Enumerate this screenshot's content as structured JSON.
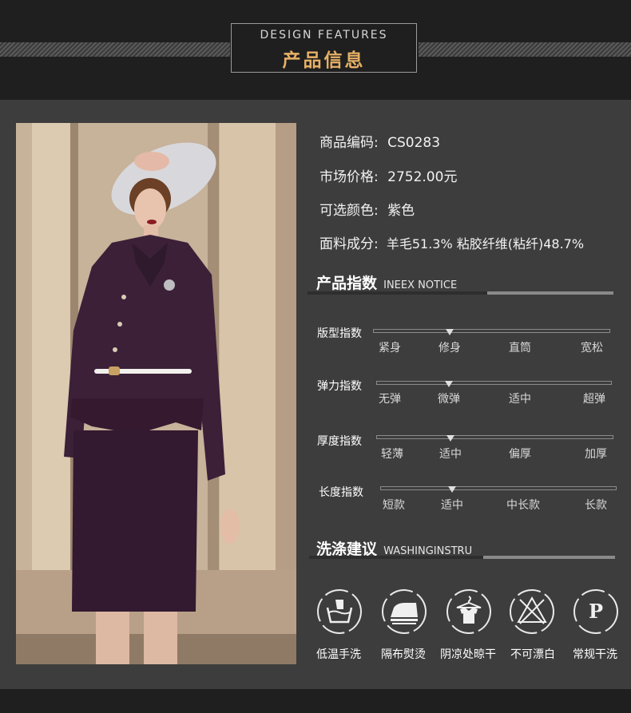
{
  "header": {
    "title_en": "DESIGN FEATURES",
    "title_cn": "产品信息"
  },
  "product": {
    "code_label": "商品编码:",
    "code_value": "CS0283",
    "price_label": "市场价格:",
    "price_value": "2752.00元",
    "color_label": "可选颜色:",
    "color_value": "紫色",
    "fabric_label": "面料成分:",
    "fabric_value": "羊毛51.3% 粘胶纤维(粘纤)48.7%"
  },
  "index_section": {
    "title_cn": "产品指数",
    "title_en": "INEEX NOTICE",
    "rows": [
      {
        "label": "版型指数",
        "options": [
          "紧身",
          "修身",
          "直筒",
          "宽松"
        ],
        "selected": 1
      },
      {
        "label": "弹力指数",
        "options": [
          "无弹",
          "微弹",
          "适中",
          "超弹"
        ],
        "selected": 1
      },
      {
        "label": "厚度指数",
        "options": [
          "轻薄",
          "适中",
          "偏厚",
          "加厚"
        ],
        "selected": 1
      },
      {
        "label": "长度指数",
        "options": [
          "短款",
          "适中",
          "中长款",
          "长款"
        ],
        "selected": 1
      }
    ]
  },
  "wash_section": {
    "title_cn": "洗涤建议",
    "title_en": "WASHINGINSTRU",
    "items": [
      {
        "label": "低温手洗",
        "icon": "hand-wash-icon"
      },
      {
        "label": "隔布熨烫",
        "icon": "iron-icon"
      },
      {
        "label": "阴凉处晾干",
        "icon": "hang-dry-icon"
      },
      {
        "label": "不可漂白",
        "icon": "no-bleach-icon"
      },
      {
        "label": "常规干洗",
        "icon": "dry-clean-icon"
      }
    ],
    "dry_clean_letter": "P"
  },
  "colors": {
    "accent": "#e7b066",
    "panel": "#3d3d3d",
    "background": "#1f1f1f",
    "garment": "#3b2038"
  }
}
